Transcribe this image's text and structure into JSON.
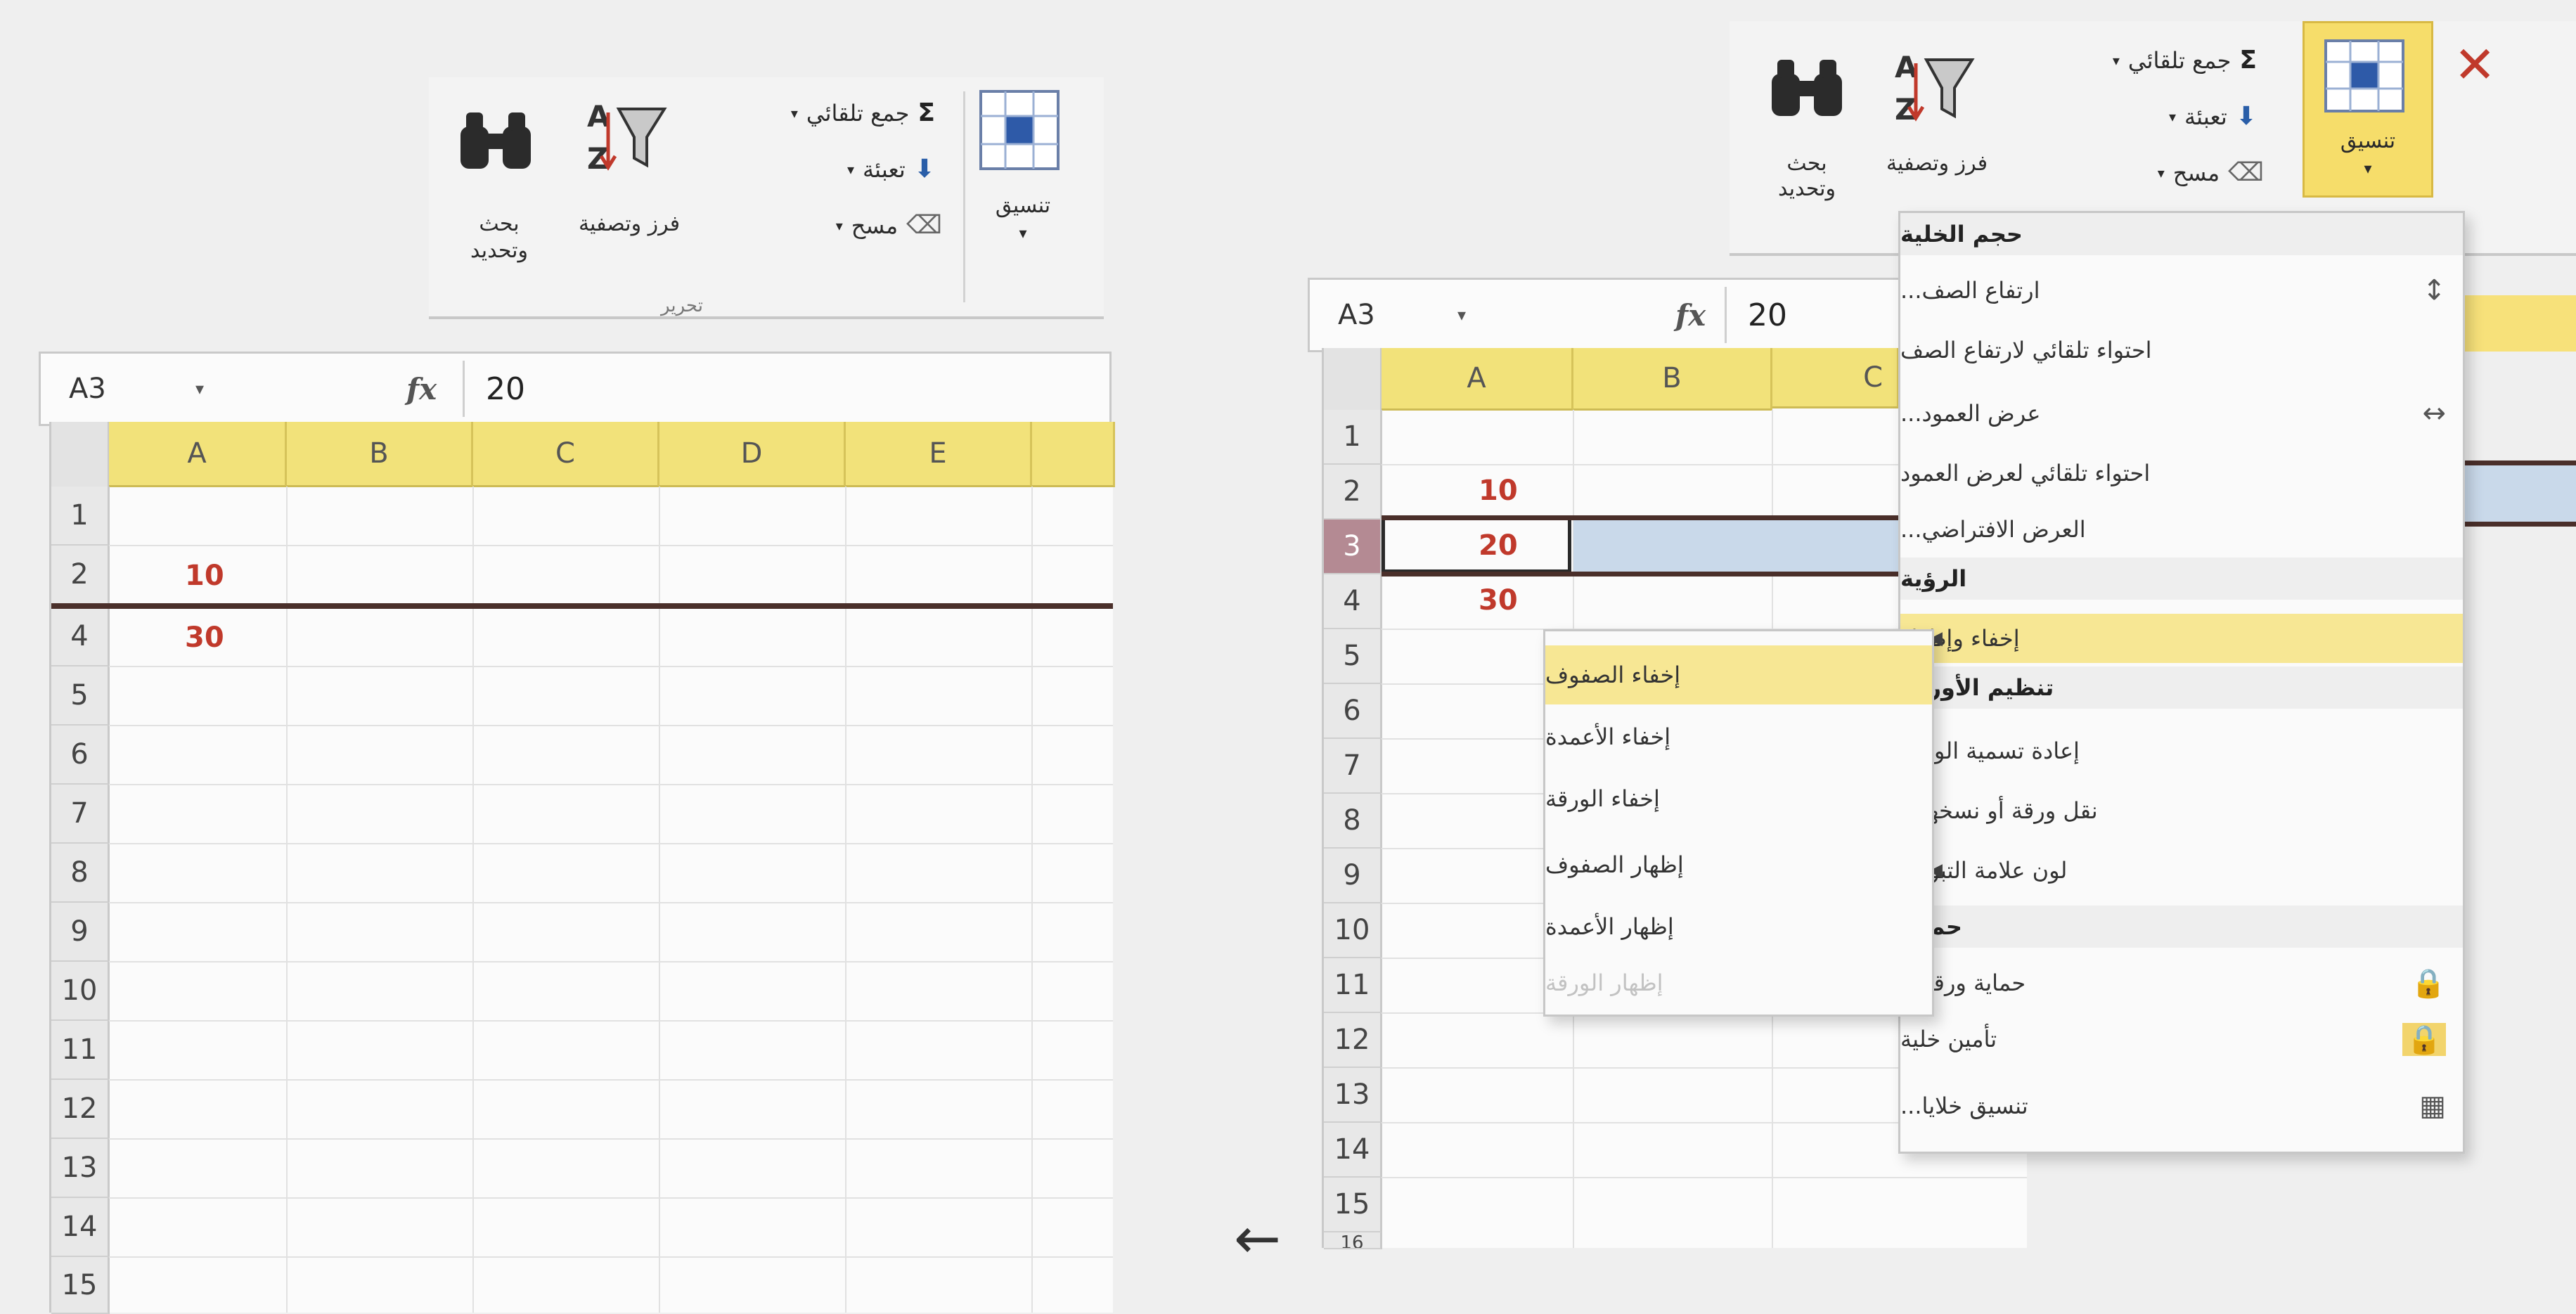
{
  "ribbon": {
    "autosum": "جمع تلقائي",
    "fill": "تعبئة",
    "clear": "مسح",
    "sort_filter": "فرز وتصفية",
    "find_select": "بحث وتحديد",
    "format": "تنسيق",
    "group_editing": "تحرير",
    "sigma_icon": "Σ",
    "sort_icon_text": "AZ"
  },
  "left": {
    "name_box": "A3",
    "fx": "fx",
    "formula_value": "20",
    "columns": [
      "A",
      "B",
      "C",
      "D",
      "E"
    ],
    "rows": [
      "1",
      "2",
      "4",
      "5",
      "6",
      "7",
      "8",
      "9",
      "10",
      "11",
      "12",
      "13",
      "14",
      "15"
    ],
    "cells": {
      "a2": "10",
      "a4": "30"
    }
  },
  "right": {
    "name_box": "A3",
    "fx": "fx",
    "formula_value": "20",
    "columns": [
      "A",
      "B",
      "C"
    ],
    "rows": [
      "1",
      "2",
      "3",
      "4",
      "5",
      "6",
      "7",
      "8",
      "9",
      "10",
      "11",
      "12",
      "13",
      "14",
      "15",
      "16"
    ],
    "cells": {
      "a2": "10",
      "a3": "20",
      "a4": "30"
    },
    "format_button": "تنسيق"
  },
  "format_menu": {
    "section_cell_size": "حجم الخلية",
    "row_height": "ارتفاع الصف...",
    "autofit_row": "احتواء تلقائي لارتفاع الصف",
    "column_width": "عرض العمود...",
    "autofit_column": "احتواء تلقائي لعرض العمود",
    "default_width": "العرض الافتراضي...",
    "section_visibility": "الرؤية",
    "hide_unhide": "إخفاء وإظهار",
    "section_organize": "تنظيم الأوراق",
    "rename_sheet": "إعادة تسمية الورقة",
    "move_copy": "نقل ورقة أو نسخها...",
    "tab_color": "لون علامة التبويب",
    "section_protection": "حماية",
    "protect_sheet": "حماية ورقة...",
    "lock_cell": "تأمين خلية",
    "format_cells": "تنسيق خلايا..."
  },
  "submenu": {
    "hide_rows": "إخفاء الصفوف",
    "hide_columns": "إخفاء الأعمدة",
    "hide_sheet": "إخفاء الورقة",
    "unhide_rows": "إظهار الصفوف",
    "unhide_columns": "إظهار الأعمدة",
    "unhide_sheet": "إظهار الورقة"
  },
  "arrow": "←",
  "colors": {
    "header_yellow": "#f2e27a",
    "highlight": "#f7e794",
    "value_red": "#c0392b"
  }
}
